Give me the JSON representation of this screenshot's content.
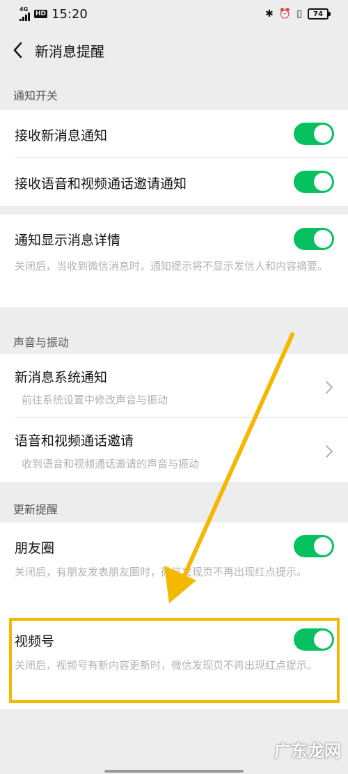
{
  "status_bar": {
    "network": "4G",
    "hd": "HD",
    "time": "15:20",
    "battery": "74",
    "icons": [
      "bluetooth-icon",
      "alarm-icon",
      "vibrate-icon",
      "battery-icon"
    ]
  },
  "nav": {
    "title": "新消息提醒",
    "back_icon": "chevron-left-icon"
  },
  "sections": {
    "notify_switch": "通知开关",
    "sound_vibrate": "声音与振动",
    "update_reminder": "更新提醒"
  },
  "rows": {
    "receive_new": {
      "title": "接收新消息通知",
      "enabled": true
    },
    "receive_call": {
      "title": "接收语音和视频通话邀请通知",
      "enabled": true
    },
    "show_detail": {
      "title": "通知显示消息详情",
      "subtitle": "关闭后，当收到微信消息时，通知提示将不显示发信人和内容摘要。",
      "enabled": true
    },
    "system_notify": {
      "title": "新消息系统通知",
      "subtitle": "前往系统设置中修改声音与振动"
    },
    "call_invite": {
      "title": "语音和视频通话邀请",
      "subtitle": "收到语音和视频通话邀请的声音与振动"
    },
    "moments": {
      "title": "朋友圈",
      "subtitle": "关闭后，有朋友发表朋友圈时，微信发现页不再出现红点提示。",
      "enabled": true
    },
    "channels": {
      "title": "视频号",
      "subtitle": "关闭后，视频号有新内容更新时，微信发现页不再出现红点提示。",
      "enabled": true
    }
  },
  "watermark": "广东龙网",
  "colors": {
    "toggle_on": "#07c160",
    "annotation": "#f5b800",
    "background": "#ededed"
  }
}
